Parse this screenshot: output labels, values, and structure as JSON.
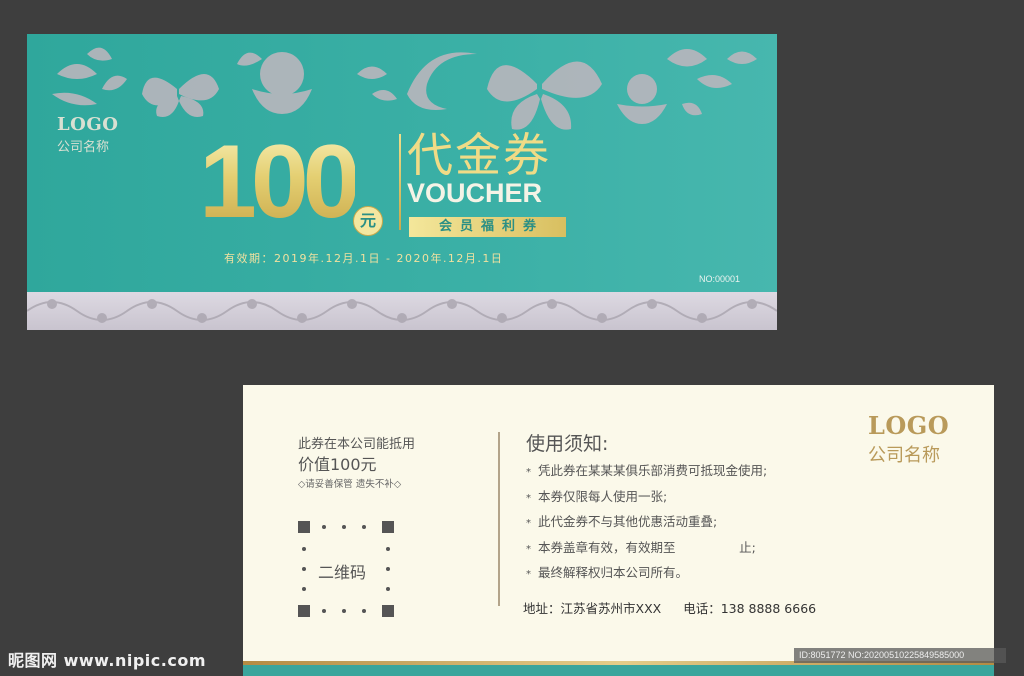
{
  "front": {
    "logo_main": "LOGO",
    "logo_sub": "公司名称",
    "value": "100",
    "currency": "元",
    "title_cn": "代金券",
    "title_en": "VOUCHER",
    "member_tag": "会员福利券",
    "validity": "有效期：2019年.12月.1日 - 2020年.12月.1日",
    "serial": "NO:00001"
  },
  "back": {
    "usage_line1": "此券在本公司能抵用",
    "usage_line2": "价值100元",
    "keep_note": "◇请妥善保管 遗失不补◇",
    "qr_label": "二维码",
    "notes_title": "使用须知:",
    "notes": [
      "凭此券在某某某俱乐部消费可抵现金使用;",
      "本券仅限每人使用一张;",
      "此代金券不与其他优惠活动重叠;",
      "本券盖章有效，有效期至                止;",
      "最终解释权归本公司所有。"
    ],
    "bullet": "*",
    "address": "地址：江苏省苏州市XXX",
    "phone": "电话：138 8888 6666",
    "logo_main": "LOGO",
    "logo_sub": "公司名称"
  },
  "watermark": {
    "site": "昵图网 www.nipic.com",
    "id": "ID:8051772 NO:20200510225849585000"
  },
  "colors": {
    "teal": "#3aafa5",
    "gold": "#e4cf72",
    "cream": "#fbf9ea",
    "background": "#3e3e3e"
  }
}
